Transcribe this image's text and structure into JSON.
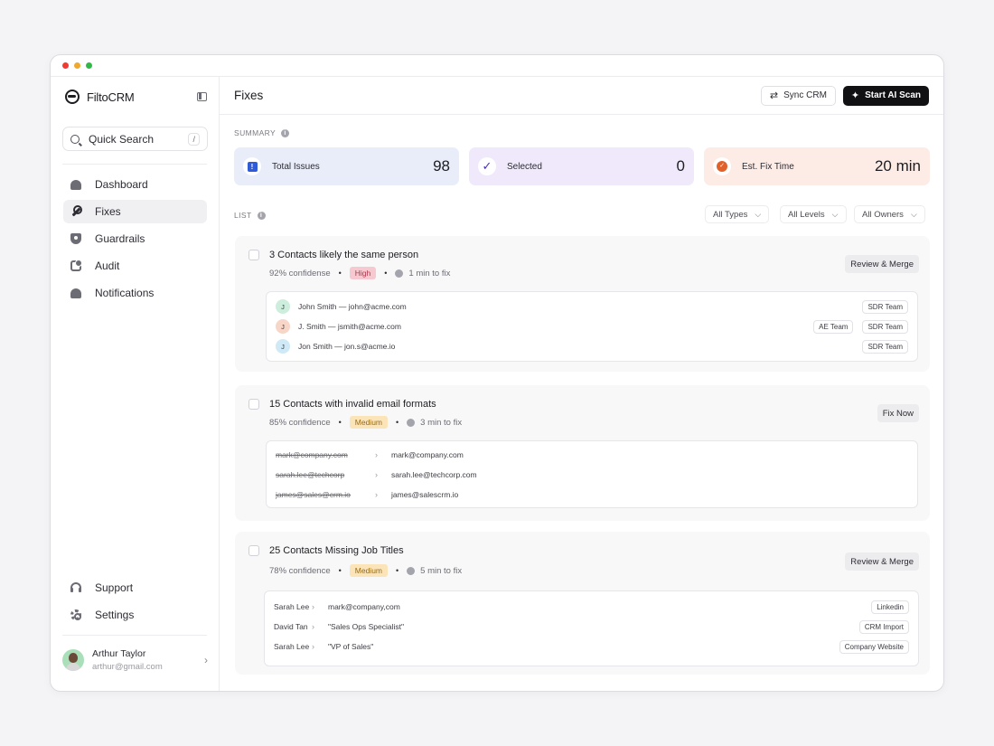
{
  "app": {
    "name": "FiltoCRM"
  },
  "sidebar": {
    "search": {
      "label": "Quick Search",
      "shortcut": "/"
    },
    "nav": [
      {
        "label": "Dashboard",
        "icon": "dashboard-icon"
      },
      {
        "label": "Fixes",
        "icon": "wrench-icon",
        "active": true
      },
      {
        "label": "Guardrails",
        "icon": "shield-icon"
      },
      {
        "label": "Audit",
        "icon": "audit-icon"
      },
      {
        "label": "Notifications",
        "icon": "bell-icon"
      }
    ],
    "bottom_nav": [
      {
        "label": "Support",
        "icon": "headset-icon"
      },
      {
        "label": "Settings",
        "icon": "gear-icon"
      }
    ],
    "user": {
      "name": "Arthur Taylor",
      "email": "arthur@gmail.com"
    }
  },
  "header": {
    "title": "Fixes",
    "sync_label": "Sync CRM",
    "scan_label": "Start AI Scan"
  },
  "summary": {
    "label": "SUMMARY",
    "stats": [
      {
        "label": "Total Issues",
        "value": "98",
        "bg": "#e8edf9",
        "icon_color": "#2f5bd8"
      },
      {
        "label": "Selected",
        "value": "0",
        "bg": "#efe9fb",
        "icon_color": "#4a2fb3"
      },
      {
        "label": "Est. Fix Time",
        "value": "20 min",
        "bg": "#fdece6",
        "icon_color": "#e0622a"
      }
    ]
  },
  "list": {
    "label": "LIST",
    "filters": [
      "All Types",
      "All Levels",
      "All Owners"
    ],
    "cards": [
      {
        "title": "3 Contacts likely the same person",
        "confidence": "92% confidense",
        "level": "High",
        "time": "1 min to fix",
        "action": "Review & Merge",
        "rows": [
          {
            "initial": "J",
            "avatar_color": "#cdeedd",
            "text": "John Smith — john@acme.com",
            "tags": [
              "SDR Team"
            ]
          },
          {
            "initial": "J",
            "avatar_color": "#f7d6c8",
            "text": "J. Smith — jsmith@acme.com",
            "tags": [
              "AE Team",
              "SDR Team"
            ]
          },
          {
            "initial": "J",
            "avatar_color": "#cfe9f6",
            "text": "Jon Smith — jon.s@acme.io",
            "tags": [
              "SDR Team"
            ]
          }
        ]
      },
      {
        "title": "15 Contacts with invalid email formats",
        "confidence": "85% confidence",
        "level": "Medium",
        "time": "3 min to fix",
        "action": "Fix Now",
        "rows": [
          {
            "old": "mark@company.com",
            "new": "mark@company.com"
          },
          {
            "old": "sarah.lee@techcorp",
            "new": "sarah.lee@techcorp.com"
          },
          {
            "old": "james@sales@crm.io",
            "new": "james@salescrm.io"
          }
        ]
      },
      {
        "title": "25 Contacts Missing Job Titles",
        "confidence": "78% confidence",
        "level": "Medium",
        "time": "5 min to fix",
        "action": "Review & Merge",
        "rows": [
          {
            "name": "Sarah Lee",
            "value": "mark@company,com",
            "tag": "Linkedin"
          },
          {
            "name": "David Tan",
            "value": "\"Sales Ops Specialist\"",
            "tag": "CRM Import"
          },
          {
            "name": "Sarah Lee",
            "value": "\"VP of Sales\"",
            "tag": "Company Website"
          }
        ]
      }
    ]
  }
}
